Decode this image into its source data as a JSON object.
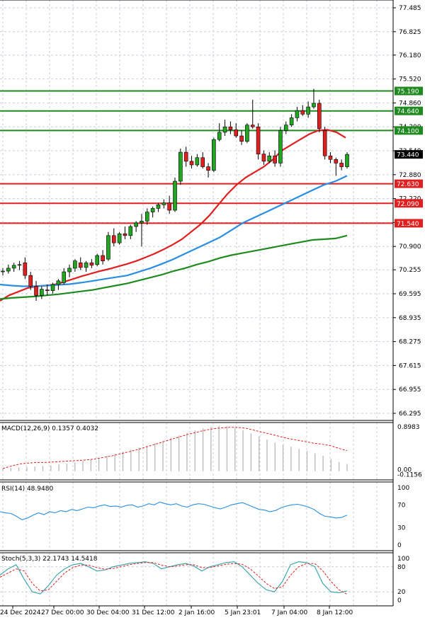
{
  "chart_data": {
    "type": "candlestick",
    "price_axis_ticks": [
      "77.485",
      "76.825",
      "76.180",
      "75.520",
      "74.860",
      "74.200",
      "73.540",
      "72.880",
      "72.220",
      "71.560",
      "70.900",
      "70.255",
      "69.595",
      "68.935",
      "68.275",
      "67.615",
      "66.955",
      "66.295"
    ],
    "x_tick_labels": [
      "24 Dec 2024",
      "27 Dec 00:00",
      "30 Dec 04:00",
      "31 Dec 12:00",
      "2 Jan 16:00",
      "5 Jan 23:01",
      "7 Jan 04:00",
      "8 Jan 12:00"
    ],
    "current_price": "73.440",
    "horizontal_levels": [
      {
        "label": "75.190",
        "value": 75.19,
        "color": "#1f8a1f"
      },
      {
        "label": "74.640",
        "value": 74.64,
        "color": "#1f8a1f"
      },
      {
        "label": "74.100",
        "value": 74.1,
        "color": "#1f8a1f"
      },
      {
        "label": "72.630",
        "value": 72.63,
        "color": "#e02020"
      },
      {
        "label": "72.090",
        "value": 72.09,
        "color": "#e02020"
      },
      {
        "label": "71.540",
        "value": 71.54,
        "color": "#e02020"
      }
    ],
    "candles": [
      {
        "o": 70.2,
        "h": 70.3,
        "l": 70.1,
        "c": 70.22
      },
      {
        "o": 70.22,
        "h": 70.4,
        "l": 70.15,
        "c": 70.3
      },
      {
        "o": 70.3,
        "h": 70.45,
        "l": 70.2,
        "c": 70.38
      },
      {
        "o": 70.38,
        "h": 70.5,
        "l": 70.25,
        "c": 70.4
      },
      {
        "o": 70.45,
        "h": 70.6,
        "l": 70.0,
        "c": 70.1
      },
      {
        "o": 70.1,
        "h": 70.2,
        "l": 69.7,
        "c": 69.8
      },
      {
        "o": 69.8,
        "h": 69.95,
        "l": 69.4,
        "c": 69.55
      },
      {
        "o": 69.55,
        "h": 69.8,
        "l": 69.45,
        "c": 69.72
      },
      {
        "o": 69.7,
        "h": 69.85,
        "l": 69.55,
        "c": 69.68
      },
      {
        "o": 69.68,
        "h": 69.9,
        "l": 69.6,
        "c": 69.85
      },
      {
        "o": 69.85,
        "h": 70.0,
        "l": 69.7,
        "c": 69.95
      },
      {
        "o": 69.9,
        "h": 70.3,
        "l": 69.85,
        "c": 70.2
      },
      {
        "o": 70.2,
        "h": 70.4,
        "l": 70.05,
        "c": 70.3
      },
      {
        "o": 70.3,
        "h": 70.55,
        "l": 70.2,
        "c": 70.5
      },
      {
        "o": 70.45,
        "h": 70.6,
        "l": 70.25,
        "c": 70.32
      },
      {
        "o": 70.32,
        "h": 70.5,
        "l": 70.2,
        "c": 70.45
      },
      {
        "o": 70.45,
        "h": 70.55,
        "l": 70.3,
        "c": 70.38
      },
      {
        "o": 70.4,
        "h": 70.7,
        "l": 70.35,
        "c": 70.65
      },
      {
        "o": 70.65,
        "h": 70.8,
        "l": 70.4,
        "c": 70.5
      },
      {
        "o": 70.55,
        "h": 71.3,
        "l": 70.5,
        "c": 71.2
      },
      {
        "o": 71.2,
        "h": 71.4,
        "l": 70.9,
        "c": 71.0
      },
      {
        "o": 71.0,
        "h": 71.3,
        "l": 70.95,
        "c": 71.25
      },
      {
        "o": 71.25,
        "h": 71.45,
        "l": 71.1,
        "c": 71.2
      },
      {
        "o": 71.2,
        "h": 71.5,
        "l": 71.1,
        "c": 71.45
      },
      {
        "o": 71.45,
        "h": 71.6,
        "l": 71.3,
        "c": 71.55
      },
      {
        "o": 71.55,
        "h": 71.8,
        "l": 70.9,
        "c": 71.6
      },
      {
        "o": 71.6,
        "h": 71.95,
        "l": 71.5,
        "c": 71.85
      },
      {
        "o": 71.85,
        "h": 72.0,
        "l": 71.7,
        "c": 71.95
      },
      {
        "o": 71.95,
        "h": 72.1,
        "l": 71.85,
        "c": 72.05
      },
      {
        "o": 72.05,
        "h": 72.2,
        "l": 71.95,
        "c": 72.1
      },
      {
        "o": 72.1,
        "h": 72.3,
        "l": 71.8,
        "c": 71.9
      },
      {
        "o": 71.9,
        "h": 72.8,
        "l": 71.85,
        "c": 72.7
      },
      {
        "o": 72.7,
        "h": 73.6,
        "l": 72.6,
        "c": 73.5
      },
      {
        "o": 73.5,
        "h": 73.65,
        "l": 73.1,
        "c": 73.25
      },
      {
        "o": 73.25,
        "h": 73.4,
        "l": 73.05,
        "c": 73.15
      },
      {
        "o": 73.15,
        "h": 73.45,
        "l": 73.1,
        "c": 73.35
      },
      {
        "o": 73.35,
        "h": 73.5,
        "l": 73.05,
        "c": 73.1
      },
      {
        "o": 73.1,
        "h": 73.2,
        "l": 72.8,
        "c": 73.0
      },
      {
        "o": 73.0,
        "h": 73.9,
        "l": 72.95,
        "c": 73.85
      },
      {
        "o": 73.85,
        "h": 74.3,
        "l": 73.8,
        "c": 74.05
      },
      {
        "o": 74.05,
        "h": 74.4,
        "l": 73.95,
        "c": 74.2
      },
      {
        "o": 74.2,
        "h": 74.35,
        "l": 74.0,
        "c": 74.12
      },
      {
        "o": 74.12,
        "h": 74.3,
        "l": 73.9,
        "c": 73.95
      },
      {
        "o": 73.95,
        "h": 74.1,
        "l": 73.7,
        "c": 73.8
      },
      {
        "o": 73.8,
        "h": 74.3,
        "l": 73.75,
        "c": 74.25
      },
      {
        "o": 74.25,
        "h": 74.95,
        "l": 74.15,
        "c": 74.2
      },
      {
        "o": 74.2,
        "h": 74.3,
        "l": 73.3,
        "c": 73.45
      },
      {
        "o": 73.45,
        "h": 73.55,
        "l": 73.15,
        "c": 73.25
      },
      {
        "o": 73.25,
        "h": 73.5,
        "l": 73.2,
        "c": 73.4
      },
      {
        "o": 73.4,
        "h": 73.55,
        "l": 73.1,
        "c": 73.2
      },
      {
        "o": 73.2,
        "h": 74.2,
        "l": 73.1,
        "c": 74.1
      },
      {
        "o": 74.1,
        "h": 74.35,
        "l": 74.0,
        "c": 74.25
      },
      {
        "o": 74.25,
        "h": 74.55,
        "l": 74.2,
        "c": 74.45
      },
      {
        "o": 74.45,
        "h": 74.75,
        "l": 74.35,
        "c": 74.65
      },
      {
        "o": 74.65,
        "h": 74.8,
        "l": 74.5,
        "c": 74.55
      },
      {
        "o": 74.55,
        "h": 74.9,
        "l": 74.45,
        "c": 74.75
      },
      {
        "o": 74.75,
        "h": 75.25,
        "l": 74.7,
        "c": 74.85
      },
      {
        "o": 74.85,
        "h": 74.95,
        "l": 74.05,
        "c": 74.15
      },
      {
        "o": 74.1,
        "h": 74.2,
        "l": 73.3,
        "c": 73.4
      },
      {
        "o": 73.4,
        "h": 73.5,
        "l": 73.2,
        "c": 73.3
      },
      {
        "o": 73.3,
        "h": 73.35,
        "l": 72.85,
        "c": 73.2
      },
      {
        "o": 73.2,
        "h": 73.3,
        "l": 73.0,
        "c": 73.1
      },
      {
        "o": 73.1,
        "h": 73.5,
        "l": 73.05,
        "c": 73.44
      }
    ],
    "moving_averages": [
      {
        "color": "#e02020",
        "values": [
          69.4,
          69.55,
          69.65,
          69.75,
          69.8,
          69.82,
          69.85,
          69.92,
          70.0,
          70.08,
          70.15,
          70.22,
          70.28,
          70.35,
          70.42,
          70.5,
          70.6,
          70.7,
          70.82,
          70.95,
          71.1,
          71.3,
          71.5,
          71.75,
          72.05,
          72.35,
          72.6,
          72.8,
          72.95,
          73.1,
          73.3,
          73.55,
          73.7,
          73.85,
          74.0,
          74.1,
          74.12,
          74.05,
          73.9
        ]
      },
      {
        "color": "#2a8ee0",
        "values": [
          69.85,
          69.82,
          69.8,
          69.8,
          69.82,
          69.84,
          69.86,
          69.9,
          69.95,
          70.0,
          70.05,
          70.1,
          70.2,
          70.3,
          70.42,
          70.55,
          70.7,
          70.85,
          71.0,
          71.15,
          71.35,
          71.55,
          71.7,
          71.85,
          72.0,
          72.15,
          72.3,
          72.45,
          72.6,
          72.7,
          72.85
        ]
      },
      {
        "color": "#1f8a1f",
        "values": [
          69.45,
          69.48,
          69.5,
          69.52,
          69.55,
          69.58,
          69.62,
          69.66,
          69.7,
          69.76,
          69.82,
          69.88,
          69.96,
          70.04,
          70.12,
          70.22,
          70.3,
          70.4,
          70.48,
          70.58,
          70.66,
          70.72,
          70.78,
          70.84,
          70.9,
          70.96,
          71.02,
          71.08,
          71.1,
          71.12,
          71.2
        ]
      }
    ],
    "macd": {
      "label": "MACD(12,26,9) 0.1357 0.4032",
      "axis_top": "0.8983",
      "axis_bottom": "0.00",
      "axis_bottom2": "-0.1156",
      "histogram": [
        0.05,
        0.06,
        0.07,
        0.08,
        0.09,
        0.1,
        0.11,
        0.13,
        0.15,
        0.17,
        0.2,
        0.23,
        0.26,
        0.3,
        0.34,
        0.38,
        0.42,
        0.46,
        0.5,
        0.55,
        0.6,
        0.65,
        0.7,
        0.75,
        0.8,
        0.84,
        0.87,
        0.89,
        0.88,
        0.85,
        0.8,
        0.74,
        0.68,
        0.62,
        0.56,
        0.52,
        0.48,
        0.44,
        0.4,
        0.35,
        0.3,
        0.24,
        0.18,
        0.14
      ],
      "signal": [
        0.05,
        0.1,
        0.14,
        0.16,
        0.17,
        0.17,
        0.18,
        0.19,
        0.2,
        0.21,
        0.22,
        0.24,
        0.27,
        0.3,
        0.34,
        0.38,
        0.42,
        0.47,
        0.52,
        0.57,
        0.62,
        0.67,
        0.72,
        0.76,
        0.8,
        0.83,
        0.85,
        0.86,
        0.86,
        0.84,
        0.8,
        0.76,
        0.72,
        0.68,
        0.64,
        0.61,
        0.58,
        0.55,
        0.53,
        0.5,
        0.45,
        0.4
      ]
    },
    "rsi": {
      "label": "RSI(14) 48.9480",
      "ticks": [
        "100",
        "70",
        "30",
        "0"
      ],
      "values": [
        58,
        56,
        55,
        50,
        44,
        47,
        52,
        56,
        53,
        58,
        56,
        60,
        58,
        62,
        60,
        63,
        66,
        65,
        68,
        70,
        67,
        68,
        66,
        69,
        70,
        66,
        68,
        72,
        70,
        75,
        72,
        70,
        72,
        68,
        66,
        70,
        72,
        71,
        68,
        65,
        63,
        66,
        70,
        72,
        74,
        70,
        66,
        62,
        61,
        58,
        60,
        65,
        68,
        70,
        71,
        69,
        66,
        62,
        55,
        50,
        49,
        47,
        48,
        52
      ]
    },
    "stoch": {
      "label": "Stoch(5,3,3) 22.1743 14.5418",
      "ticks": [
        "100",
        "80",
        "20",
        "0"
      ],
      "k": [
        60,
        75,
        85,
        50,
        20,
        15,
        35,
        60,
        75,
        85,
        88,
        80,
        70,
        72,
        80,
        84,
        88,
        90,
        92,
        88,
        75,
        80,
        85,
        88,
        82,
        70,
        80,
        85,
        90,
        92,
        80,
        60,
        40,
        25,
        20,
        45,
        85,
        92,
        90,
        80,
        40,
        20,
        18,
        22
      ],
      "d": [
        55,
        65,
        75,
        70,
        40,
        22,
        25,
        45,
        65,
        78,
        84,
        84,
        78,
        74,
        76,
        80,
        85,
        88,
        90,
        90,
        84,
        80,
        82,
        85,
        85,
        78,
        78,
        82,
        86,
        88,
        86,
        75,
        58,
        40,
        28,
        32,
        60,
        80,
        88,
        88,
        70,
        45,
        25,
        14
      ]
    }
  }
}
